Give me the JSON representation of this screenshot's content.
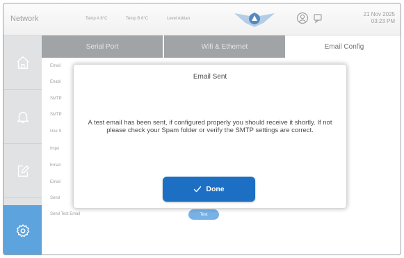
{
  "header": {
    "title": "Network",
    "temp_a": "Temp A  8°C",
    "temp_b": "Temp B  6°C",
    "level": "Level  Adrian",
    "date_line1": "21 Nov 2025",
    "date_line2": "03:23 PM"
  },
  "sidebar": {
    "items": [
      {
        "name": "home",
        "icon": "home-icon"
      },
      {
        "name": "alarms",
        "icon": "bell-icon"
      },
      {
        "name": "edit",
        "icon": "edit-icon"
      },
      {
        "name": "settings",
        "icon": "gear-icon",
        "active": true
      }
    ]
  },
  "tabs": [
    {
      "label": "Serial Port"
    },
    {
      "label": "Wifi & Ethernet"
    },
    {
      "label": "Email Config"
    }
  ],
  "form": {
    "labels": [
      "Email",
      "Enabl",
      "SMTP",
      "SMTP",
      "Use S",
      "Impo",
      "Email",
      "Email",
      "Send"
    ],
    "send_test_label": "Send Test Email",
    "test_button": "Test"
  },
  "modal": {
    "title": "Email Sent",
    "message": "A test email has been sent, if configured properly you should receive it shortly. If not please check your Spam folder or verify the SMTP settings are correct.",
    "done_label": "Done"
  },
  "colors": {
    "accent": "#1d6fc4",
    "sidebar_active": "#3a8fd6",
    "tab_inactive": "#8c9094"
  }
}
